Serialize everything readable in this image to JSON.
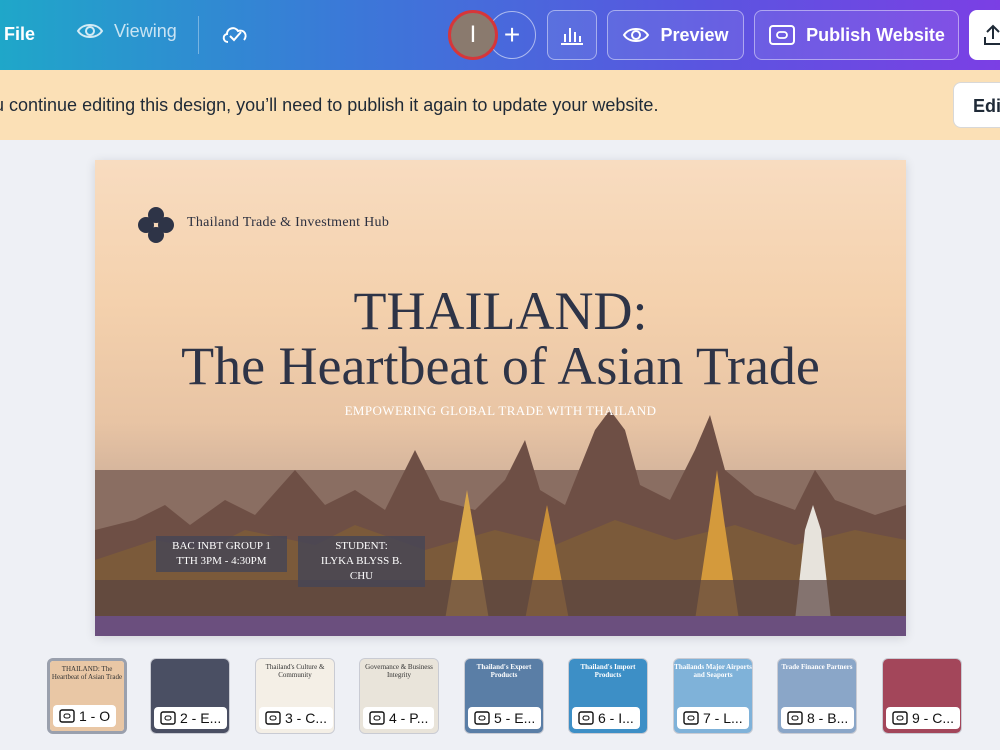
{
  "toolbar": {
    "file_label": "File",
    "viewing_label": "Viewing",
    "avatar_initial": "I",
    "add_label": "+",
    "preview_label": "Preview",
    "publish_label": "Publish Website",
    "colors": {
      "gradient_start": "#1fa7c9",
      "gradient_end": "#7b3fe4",
      "avatar_ring": "#d6363a"
    }
  },
  "notice": {
    "text": "u continue editing this design, you’ll need to publish it again to update your website.",
    "edit_label": "Edi"
  },
  "slide": {
    "brand": "Thailand Trade & Investment Hub",
    "title_line1": "THAILAND:",
    "title_line2": "The Heartbeat of Asian Trade",
    "subtitle": "EMPOWERING GLOBAL TRADE WITH THAILAND",
    "tag1_line1": "BAC INBT GROUP 1",
    "tag1_line2": "TTH 3PM - 4:30PM",
    "tag2_line1": "STUDENT:",
    "tag2_line2": "ILYKA BLYSS B. CHU"
  },
  "pages": [
    {
      "label": "1 - O",
      "mini": "THAILAND: The Heartbeat of Asian Trade",
      "selected": true,
      "bg": "#e9c7a5"
    },
    {
      "label": "2 - E...",
      "mini": "",
      "bg": "#4a4f63"
    },
    {
      "label": "3 - C...",
      "mini": "Thailand's Culture & Community",
      "bg": "#f4efe6"
    },
    {
      "label": "4 - P...",
      "mini": "Governance & Business Integrity",
      "bg": "#e9e4da"
    },
    {
      "label": "5 - E...",
      "mini": "Thailand's Export Products",
      "bg": "#5a7ea6"
    },
    {
      "label": "6 - I...",
      "mini": "Thailand's Import Products",
      "bg": "#3d8fc6"
    },
    {
      "label": "7 - L...",
      "mini": "Thailands Major Airports and Seaports",
      "bg": "#7fb2d9"
    },
    {
      "label": "8 - B...",
      "mini": "Trade Finance Partners",
      "bg": "#8aa6c8"
    },
    {
      "label": "9 - C...",
      "mini": "",
      "bg": "#a3465a"
    }
  ]
}
